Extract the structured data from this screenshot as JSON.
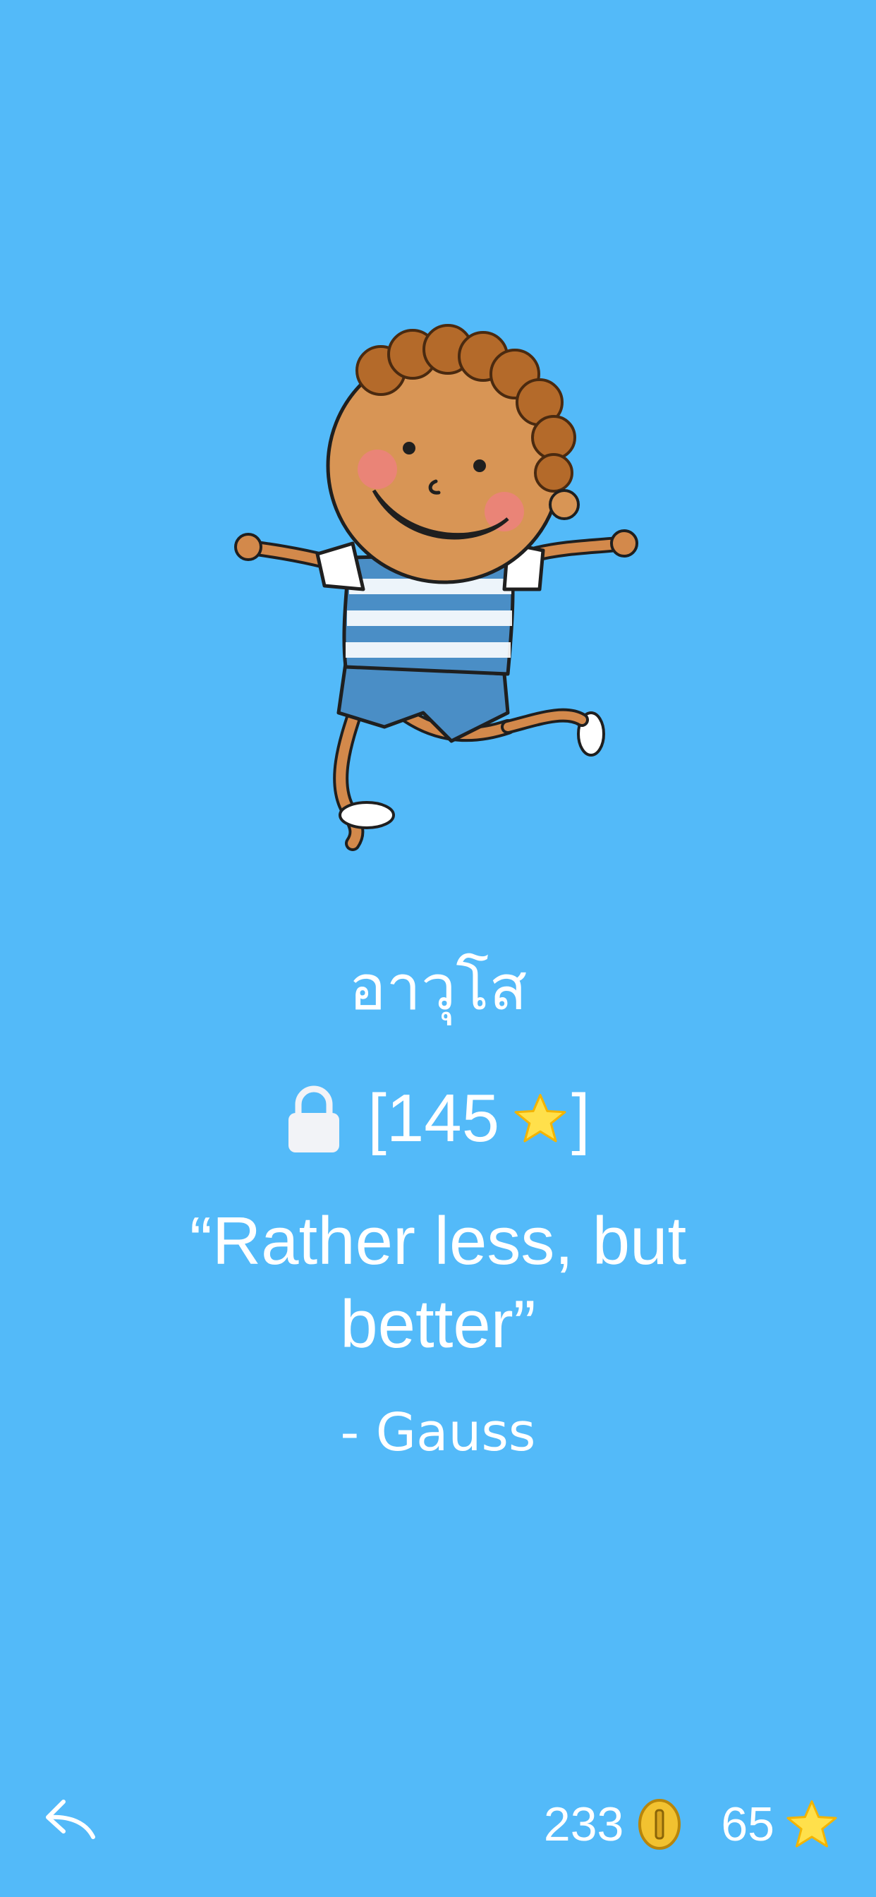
{
  "character": {
    "name": "อาวุโส"
  },
  "unlock": {
    "open_bracket": "[",
    "cost": "145",
    "close_bracket": "]"
  },
  "quote": {
    "text": "“Rather less, but better”",
    "author": "- Gauss"
  },
  "footer": {
    "coins": "233",
    "stars": "65"
  },
  "icons": {
    "back": "back-arrow-icon",
    "lock": "lock-icon",
    "coin": "coin-icon",
    "star": "star-icon"
  },
  "colors": {
    "background": "#53baf9",
    "text": "#ffffff",
    "star": "#ffe04b",
    "coin": "#f2c230"
  }
}
